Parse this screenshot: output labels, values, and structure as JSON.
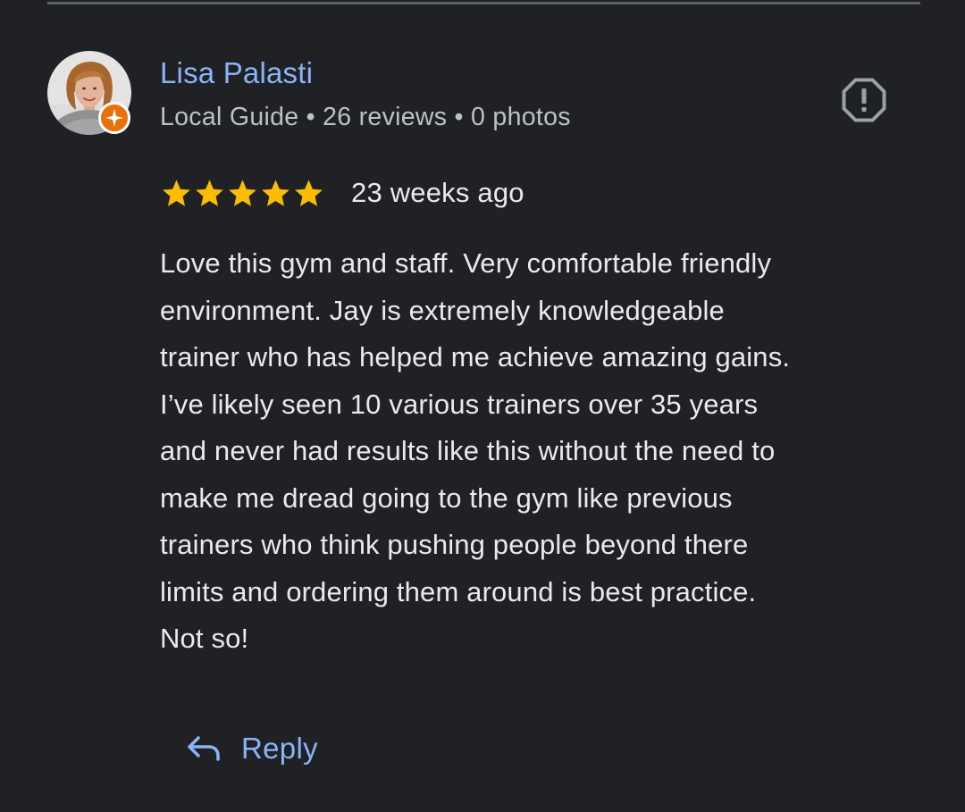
{
  "review": {
    "reviewer": {
      "name": "Lisa Palasti",
      "meta": "Local Guide • 26 reviews • 0 photos",
      "avatar_icon": "avatar-photo",
      "badge_icon": "local-guide-star-icon"
    },
    "rating": 5,
    "max_rating": 5,
    "date": "23 weeks ago",
    "text_lines": [
      "Love this gym and staff. Very comfortable friendly",
      "environment. Jay is extremely knowledgeable",
      "trainer who has helped me achieve amazing gains.",
      "I’ve likely seen 10 various trainers over 35 years",
      "and never had results like this without the need to",
      "make me dread going to the gym like previous",
      "trainers who think pushing people beyond there",
      "limits and ordering them around is best practice.",
      "Not so!"
    ],
    "report_icon": "report-icon",
    "reply_label": "Reply",
    "reply_icon": "reply-arrow-icon"
  },
  "colors": {
    "background": "#202124",
    "link": "#8ab4f8",
    "text": "#e8eaed",
    "secondary_text": "#bdc1c6",
    "star": "#fbbc04",
    "badge": "#e8710a",
    "divider": "#5f6368"
  }
}
